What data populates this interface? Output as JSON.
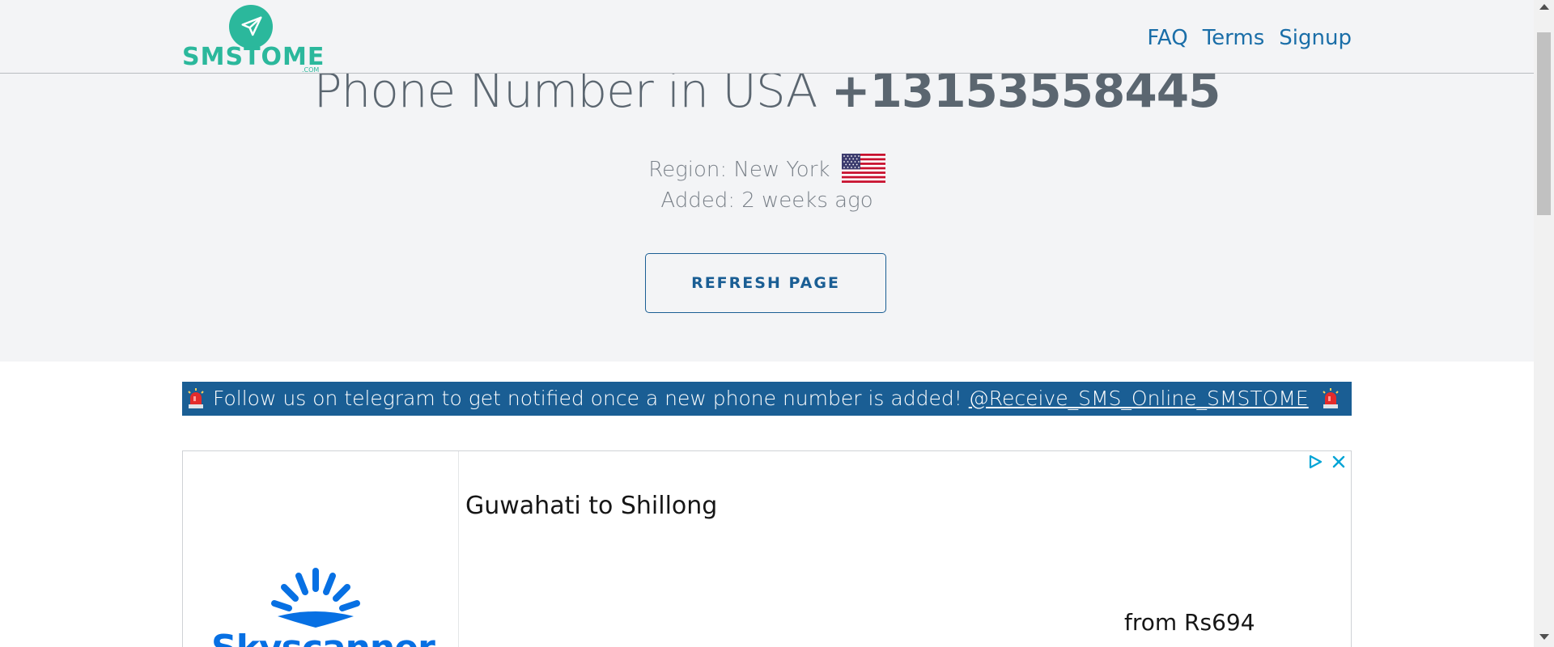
{
  "header": {
    "logo_text": "SMSTOME",
    "logo_suffix": ".COM",
    "nav": [
      {
        "label": "FAQ"
      },
      {
        "label": "Terms"
      },
      {
        "label": "Signup"
      }
    ]
  },
  "hero": {
    "title_prefix": "Phone Number in USA",
    "phone_number": "+13153558445",
    "region": "Region: New York",
    "added": "Added: 2 weeks ago",
    "refresh_label": "REFRESH PAGE"
  },
  "telegram": {
    "text": "Follow us on telegram to get notified once a new phone number is added!",
    "link_text": "@Receive_SMS_Online_SMSTOME"
  },
  "ad": {
    "brand": "Skyscanner",
    "headline": "Guwahati to Shillong",
    "price": "from Rs694"
  },
  "colors": {
    "brand_green": "#2bb89c",
    "link_blue": "#1a6ea8",
    "telegram_bar": "#1a5e94",
    "skyscanner_blue": "#0770e3"
  }
}
